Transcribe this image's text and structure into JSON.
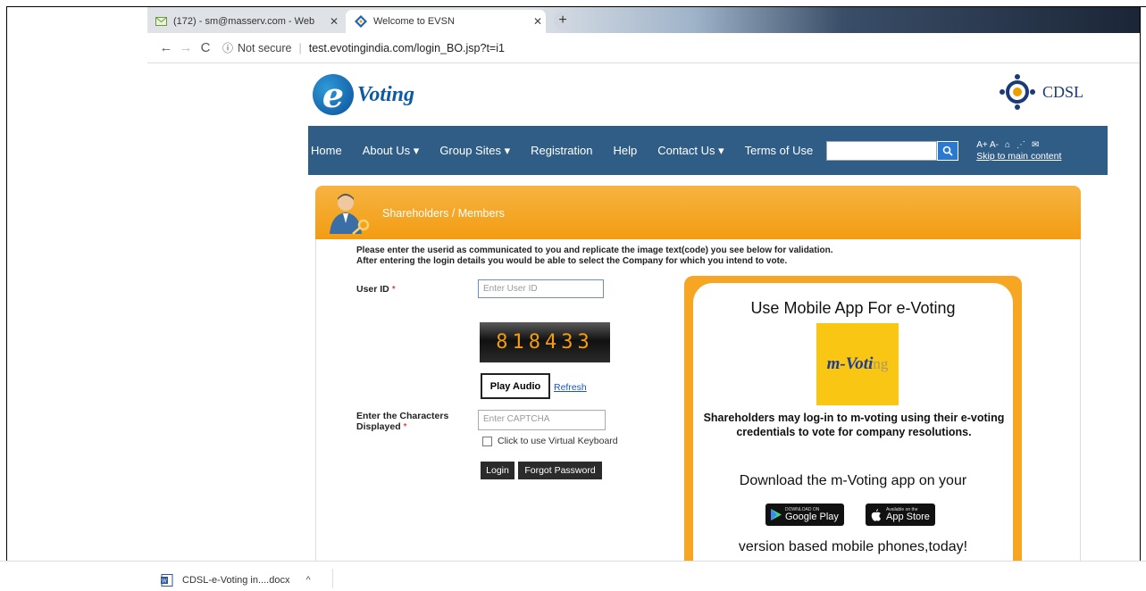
{
  "browser": {
    "tabs": [
      {
        "title": "(172) - sm@masserv.com - Web",
        "icon": "mail-icon"
      },
      {
        "title": "Welcome to EVSN",
        "icon": "diamond-icon"
      }
    ],
    "address": {
      "security": "Not secure",
      "url": "test.evotingindia.com/login_BO.jsp?t=i1"
    }
  },
  "site": {
    "logo_text": "Voting",
    "logo_letter": "e",
    "cdsl_text": "CDSL",
    "nav": [
      "Home",
      "About Us ▾",
      "Group Sites ▾",
      "Registration",
      "Help",
      "Contact Us ▾",
      "Terms of Use"
    ],
    "tools_icons": "A+ A- ",
    "skip_link": "Skip to main content"
  },
  "panel": {
    "title": "Shareholders / Members",
    "instructions_line1": "Please enter the userid as communicated to you and replicate the image text(code) you see below for validation.",
    "instructions_line2": "After entering the login details you would be able to select the Company for which you intend to vote.",
    "userid_label": "User ID",
    "userid_placeholder": "Enter User ID",
    "captcha_code": "818433",
    "play_audio": "Play Audio",
    "refresh": "Refresh",
    "chars_label_1": "Enter the Characters",
    "chars_label_2": "Displayed",
    "captcha_placeholder": "Enter CAPTCHA",
    "virtual_keyboard": "Click to use Virtual Keyboard",
    "login": "Login",
    "forgot": "Forgot Password"
  },
  "promo": {
    "title": "Use Mobile App For e-Voting",
    "logo_main": "m-Voti",
    "logo_fade": "ng",
    "desc": "Shareholders may log-in to m-voting using their e-voting credentials to vote for company resolutions.",
    "download": "Download the m-Voting app on your",
    "google_small": "DOWNLOAD ON",
    "google_big": "Google Play",
    "apple_small": "Available on the",
    "apple_big": "App Store",
    "footer": "version based mobile phones,today!"
  },
  "downloads": {
    "file": "CDSL-e-Voting in....docx"
  }
}
